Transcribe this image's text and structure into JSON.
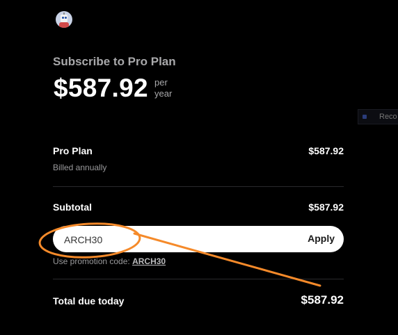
{
  "merchant": {
    "logo_icon": "robot-avatar-icon"
  },
  "header": {
    "title": "Subscribe to Pro Plan",
    "price": "$587.92",
    "period_line1": "per",
    "period_line2": "year"
  },
  "side_tab": {
    "label": "Reco"
  },
  "line_item": {
    "name": "Pro Plan",
    "billing": "Billed annually",
    "amount": "$587.92"
  },
  "subtotal": {
    "label": "Subtotal",
    "amount": "$587.92"
  },
  "promo": {
    "value": "ARCH30",
    "apply_label": "Apply",
    "hint_prefix": "Use promotion code:",
    "hint_code": "ARCH30"
  },
  "total": {
    "label": "Total due today",
    "amount": "$587.92"
  },
  "annotation": {
    "color": "#f58a2a"
  }
}
